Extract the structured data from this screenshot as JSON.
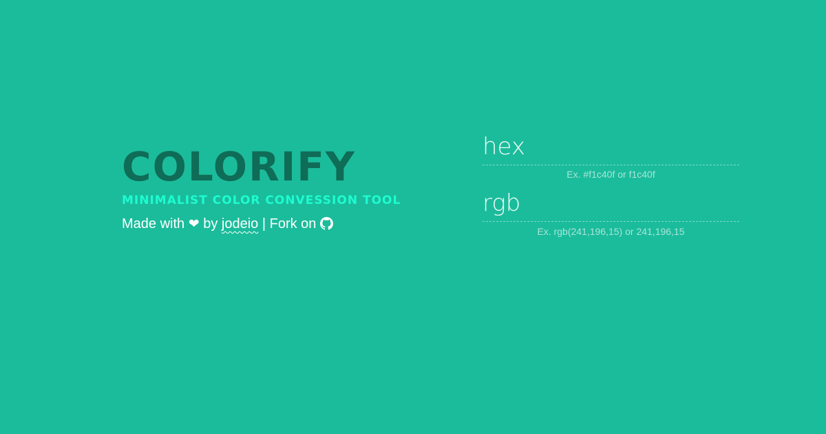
{
  "colors": {
    "background": "#1bbc9b",
    "title": "#0f6c57",
    "subtitle": "#1dfcd1",
    "text": "#ffffff"
  },
  "brand": {
    "title": "COLORIFY",
    "subtitle": "MINIMALIST COLOR CONVESSION TOOL",
    "credits": {
      "made_with": "Made with",
      "heart": "❤",
      "by": "by",
      "author": "jodeio",
      "separator": "|",
      "fork": "Fork on",
      "github_icon": "github-icon"
    }
  },
  "fields": {
    "hex": {
      "placeholder": "hex",
      "value": "",
      "hint": "Ex. #f1c40f or f1c40f"
    },
    "rgb": {
      "placeholder": "rgb",
      "value": "",
      "hint": "Ex. rgb(241,196,15) or 241,196,15"
    }
  }
}
